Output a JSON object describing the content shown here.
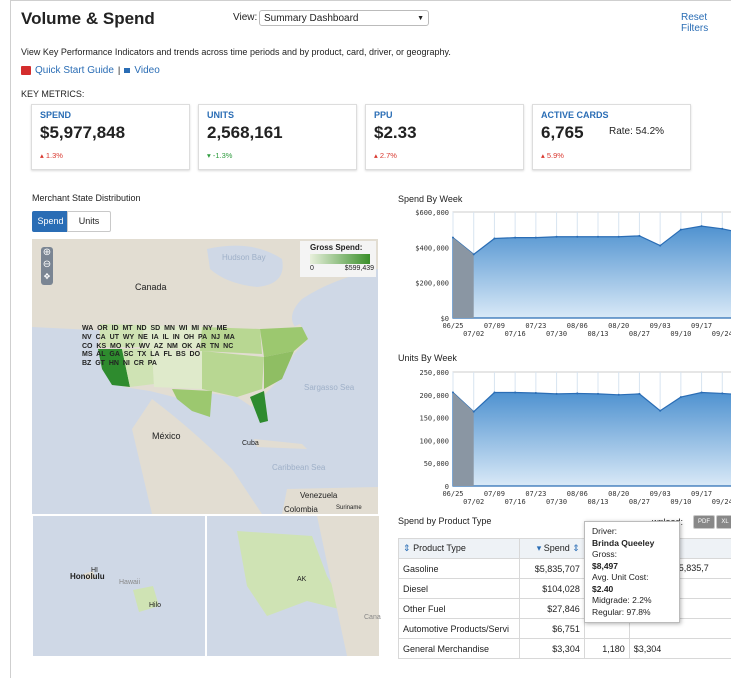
{
  "header": {
    "title": "Volume & Spend",
    "view_label": "View:",
    "view_value": "Summary Dashboard",
    "reset_label": "Reset Filters",
    "description": "View Key Performance Indicators and trends across time periods and by product, card, driver, or geography.",
    "quick_start": "Quick Start Guide",
    "separator": "|",
    "video": "Video"
  },
  "key_metrics_label": "KEY METRICS:",
  "metrics": [
    {
      "label": "SPEND",
      "value": "$5,977,848",
      "change": "1.3%",
      "direction": "up"
    },
    {
      "label": "UNITS",
      "value": "2,568,161",
      "change": "-1.3%",
      "direction": "down"
    },
    {
      "label": "PPU",
      "value": "$2.33",
      "change": "2.7%",
      "direction": "up"
    },
    {
      "label": "ACTIVE CARDS",
      "value": "6,765",
      "rate": "Rate: 54.2%",
      "change": "5.9%",
      "direction": "up"
    }
  ],
  "map": {
    "title": "Merchant State Distribution",
    "toggle": [
      "Spend",
      "Units"
    ],
    "legend_title": "Gross Spend:",
    "legend_min": "0",
    "legend_max": "$599,439",
    "labels": {
      "hudson": "Hudson Bay",
      "canada": "Canada",
      "mexico": "México",
      "sargasso": "Sargasso Sea",
      "caribbean": "Caribbean Sea",
      "cuba": "Cuba",
      "venezuela": "Venezuela",
      "colombia": "Colombia",
      "suriname": "Suriname",
      "honolulu": "Honolulu",
      "hawaii": "Hawaii",
      "hilo": "Hilo",
      "hi": "HI",
      "ak": "AK",
      "cana": "Cana"
    },
    "states": [
      "WA",
      "OR",
      "ID",
      "MT",
      "ND",
      "SD",
      "MN",
      "WI",
      "MI",
      "NY",
      "ME",
      "NV",
      "CA",
      "UT",
      "WY",
      "NE",
      "IA",
      "IL",
      "IN",
      "OH",
      "PA",
      "NJ",
      "MA",
      "CO",
      "KS",
      "MO",
      "KY",
      "WV",
      "AZ",
      "NM",
      "OK",
      "AR",
      "TN",
      "NC",
      "MS",
      "AL",
      "GA",
      "SC",
      "TX",
      "LA",
      "FL",
      "BS",
      "DO",
      "BZ",
      "GT",
      "HN",
      "NI",
      "CR",
      "PA"
    ]
  },
  "spend_chart": {
    "title": "Spend By Week",
    "y_ticks": [
      "$600,000",
      "$400,000",
      "$200,000",
      "$0"
    ],
    "x_ticks_top": [
      "06/25",
      "07/09",
      "07/23",
      "08/06",
      "08/20",
      "09/03",
      "09/17",
      "10"
    ],
    "x_ticks_bottom": [
      "07/02",
      "07/16",
      "07/30",
      "08/13",
      "08/27",
      "09/10",
      "09/24"
    ]
  },
  "units_chart": {
    "title": "Units By Week",
    "y_ticks": [
      "250,000",
      "200,000",
      "150,000",
      "100,000",
      "50,000",
      "0"
    ],
    "x_ticks_top": [
      "06/25",
      "07/09",
      "07/23",
      "08/06",
      "08/20",
      "09/03",
      "09/17",
      "10"
    ],
    "x_ticks_bottom": [
      "07/02",
      "07/16",
      "07/30",
      "08/13",
      "08/27",
      "09/10",
      "09/24"
    ]
  },
  "chart_data": [
    {
      "type": "area",
      "title": "Spend By Week",
      "x": [
        "06/25",
        "07/02",
        "07/09",
        "07/16",
        "07/23",
        "07/30",
        "08/06",
        "08/13",
        "08/20",
        "08/27",
        "09/03",
        "09/10",
        "09/17",
        "09/24",
        "10/01"
      ],
      "series": [
        {
          "values": [
            455000,
            360000,
            450000,
            455000,
            455000,
            460000,
            460000,
            460000,
            460000,
            465000,
            410000,
            500000,
            520000,
            505000,
            480000
          ]
        }
      ],
      "ylim": [
        0,
        600000
      ]
    },
    {
      "type": "area",
      "title": "Units By Week",
      "x": [
        "06/25",
        "07/02",
        "07/09",
        "07/16",
        "07/23",
        "07/30",
        "08/06",
        "08/13",
        "08/20",
        "08/27",
        "09/03",
        "09/10",
        "09/17",
        "09/24",
        "10/01"
      ],
      "series": [
        {
          "values": [
            205000,
            163000,
            205000,
            205000,
            204000,
            202000,
            203000,
            202000,
            200000,
            202000,
            165000,
            195000,
            205000,
            203000,
            200000
          ]
        }
      ],
      "ylim": [
        0,
        250000
      ]
    }
  ],
  "product_table": {
    "title": "Spend by Product Type",
    "download_label": "wnload:",
    "pdf": "PDF",
    "xls": "XL",
    "headers": [
      "Product Type",
      "Spend",
      "",
      ""
    ],
    "rows": [
      {
        "type": "Gasoline",
        "spend": "$5,835,707",
        "c3": "2",
        "bar_label": "$5,835,7",
        "share": 0.97
      },
      {
        "type": "Diesel",
        "spend": "$104,028",
        "c3": "",
        "bar_label": "",
        "share": 0.02
      },
      {
        "type": "Other Fuel",
        "spend": "$27,846",
        "c3": "",
        "bar_label": "",
        "share": 0.005
      },
      {
        "type": "Automotive Products/Servi",
        "spend": "$6,751",
        "c3": "",
        "bar_label": "",
        "share": 0.001
      },
      {
        "type": "General Merchandise",
        "spend": "$3,304",
        "c3": "1,180",
        "bar_label": "$3,304",
        "share": 0.0005
      }
    ]
  },
  "tooltip": {
    "driver_label": "Driver:",
    "driver": "Brinda Queeley",
    "gross_label": "Gross:",
    "gross": "$8,497",
    "avg_label": "Avg. Unit Cost:",
    "avg": "$2.40",
    "midgrade": "Midgrade: 2.2%",
    "regular": "Regular: 97.8%"
  },
  "colors": {
    "accent": "#2a6db5",
    "area": "#5b9fd8",
    "up": "#d9382f",
    "down": "#2e9c3e"
  }
}
